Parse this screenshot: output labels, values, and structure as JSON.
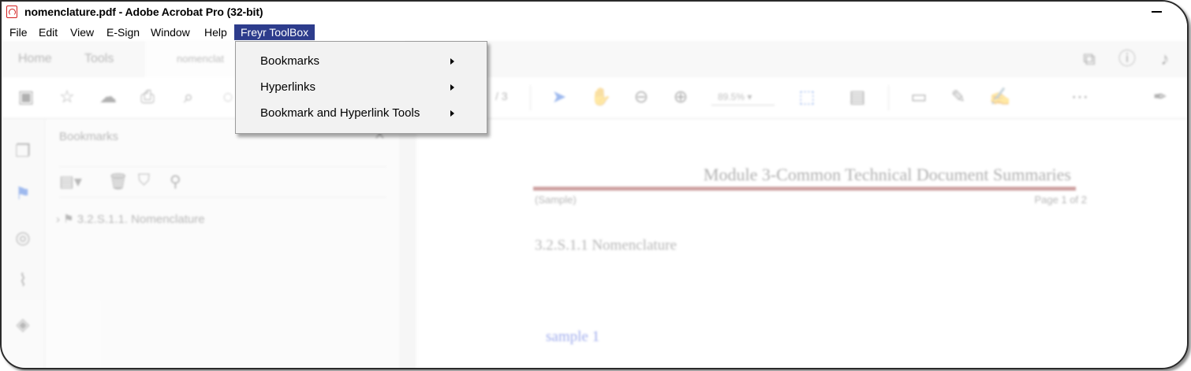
{
  "window": {
    "title": "nomenclature.pdf - Adobe Acrobat Pro (32-bit)"
  },
  "menubar": {
    "items": [
      "File",
      "Edit",
      "View",
      "E-Sign",
      "Window",
      "Help",
      "Freyr ToolBox"
    ]
  },
  "tabs": {
    "home": "Home",
    "tools": "Tools",
    "document": "nomenclat"
  },
  "toolbar": {
    "page_count": "/ 3",
    "zoom": "89.5%"
  },
  "bookmarks_panel": {
    "title": "Bookmarks",
    "items": [
      {
        "label": "3.2.S.1.1. Nomenclature"
      }
    ]
  },
  "document": {
    "header_title": "Module 3-Common Technical Document Summaries",
    "header_left": "(Sample)",
    "header_right": "Page 1 of 2",
    "section_heading": "3.2.S.1.1 Nomenclature",
    "link_text": "sample 1"
  },
  "dropdown_menu": {
    "items": [
      {
        "label": "Bookmarks"
      },
      {
        "label": "Hyperlinks"
      },
      {
        "label": "Bookmark and Hyperlink Tools"
      }
    ]
  },
  "colors": {
    "menu_highlight": "#2d3c8c",
    "accent_blue": "#1b5bd8",
    "header_rule": "#8b1f1f"
  }
}
